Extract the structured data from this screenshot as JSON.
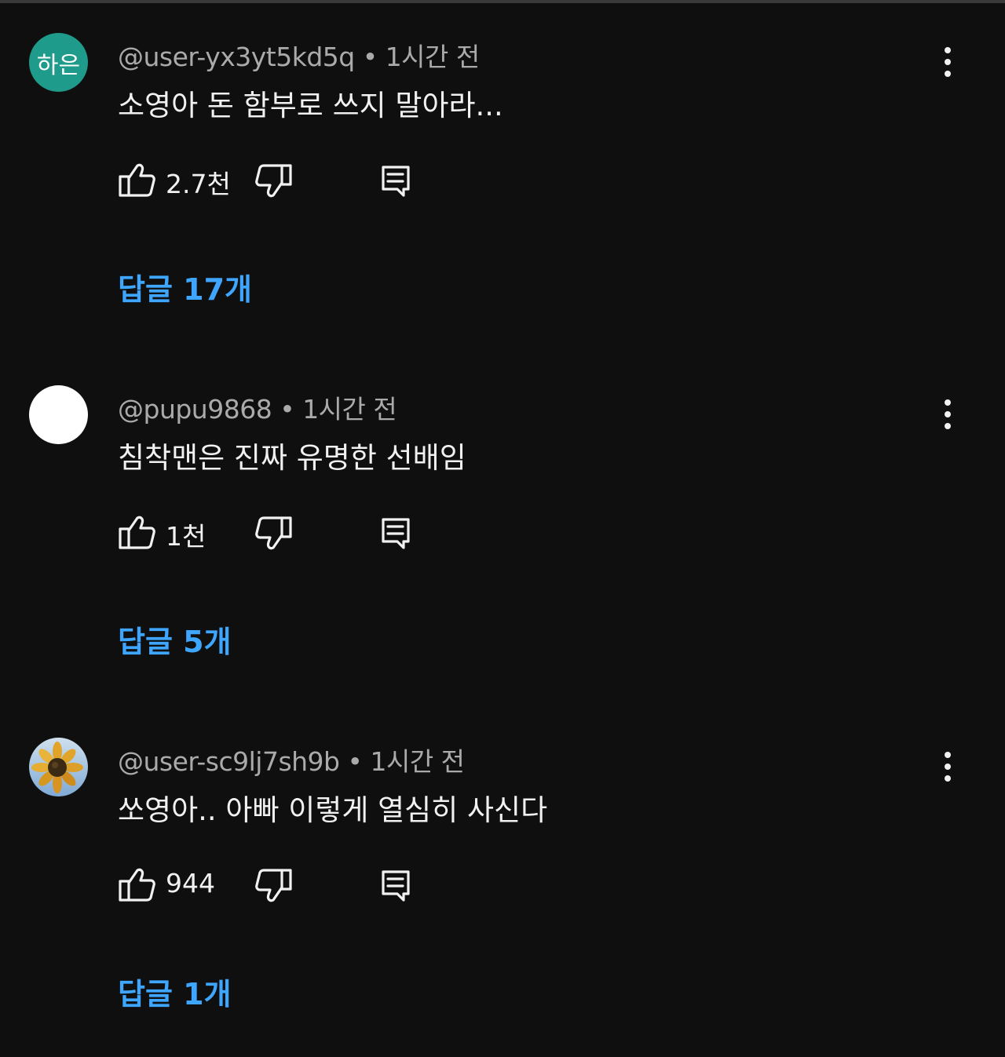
{
  "comments": [
    {
      "avatar_text": "하은",
      "avatar_color": "#1e9b8a",
      "author": "@user-yx3yt5kd5q",
      "separator": "•",
      "time": "1시간 전",
      "text": "소영아 돈 함부로 쓰지 말아라...",
      "likes": "2.7천",
      "replies_label": "답글 17개"
    },
    {
      "avatar_text": "",
      "avatar_color": "#ffffff",
      "author": "@pupu9868",
      "separator": "•",
      "time": "1시간 전",
      "text": "침착맨은 진짜 유명한 선배임",
      "likes": "1천",
      "replies_label": "답글 5개"
    },
    {
      "avatar_text": "",
      "avatar_color": "#8fb3d9",
      "author": "@user-sc9lj7sh9b",
      "separator": "•",
      "time": "1시간 전",
      "text": "쏘영아.. 아빠 이렇게 열심히 사신다",
      "likes": "944",
      "replies_label": "답글 1개"
    }
  ],
  "icons": {
    "like": "thumbs-up-icon",
    "dislike": "thumbs-down-icon",
    "reply": "reply-comment-icon",
    "more": "more-vertical-icon"
  },
  "colors": {
    "background": "#0f0f0f",
    "link_blue": "#3ea6ff",
    "meta_gray": "#aaaaaa",
    "text": "#f1f1f1"
  }
}
